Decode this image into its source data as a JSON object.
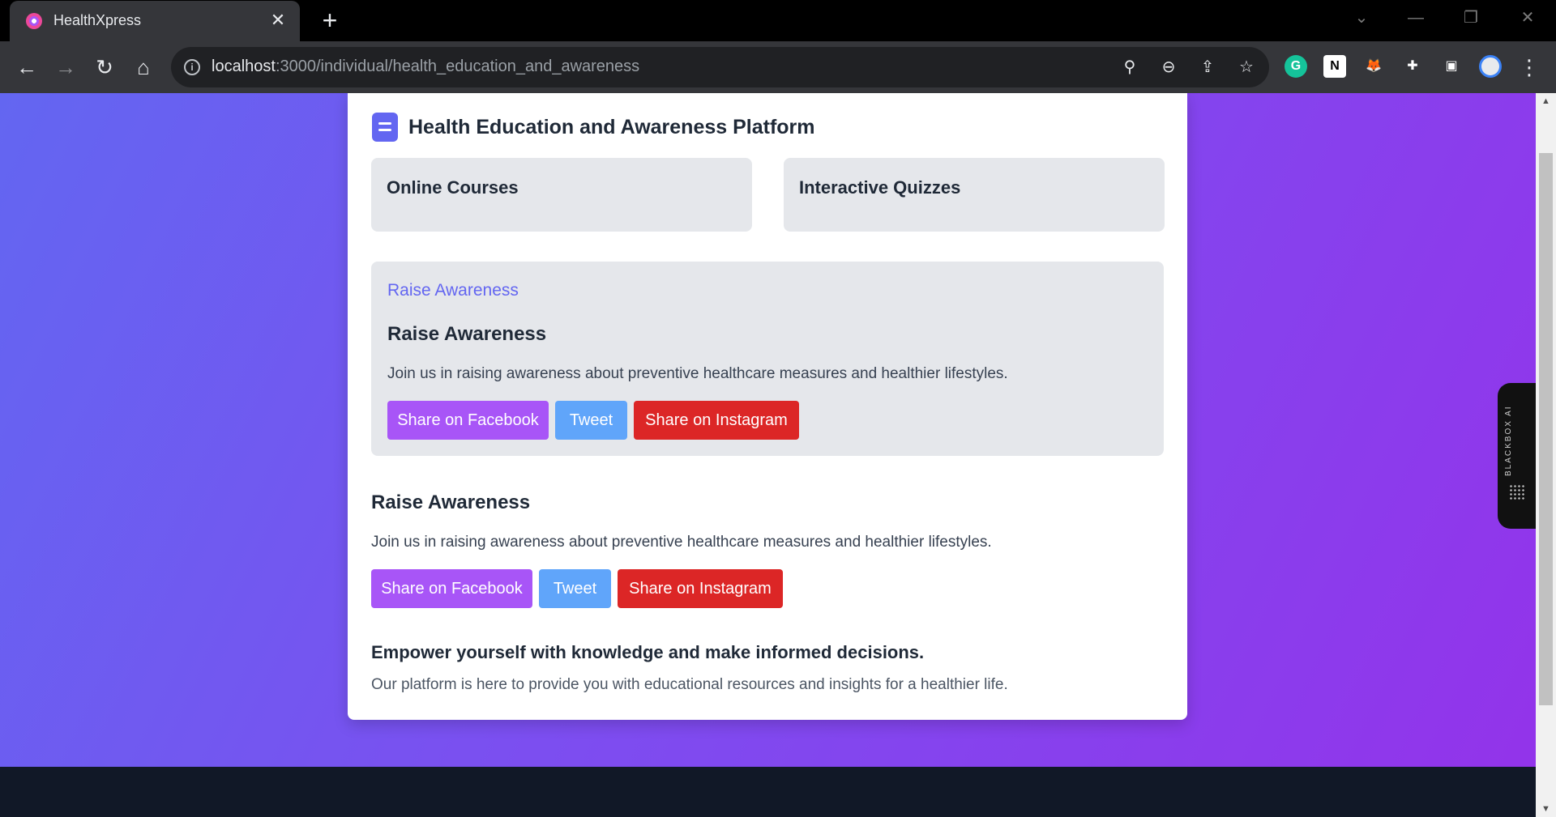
{
  "browser": {
    "tab_title": "HealthXpress",
    "tab_close": "✕",
    "new_tab": "+",
    "url_host": "localhost",
    "url_path": ":3000/individual/health_education_and_awareness",
    "window_controls": {
      "dropdown": "⌄",
      "minimize": "—",
      "restore": "❐",
      "close": "✕"
    },
    "nav": {
      "back": "←",
      "forward": "→",
      "reload": "↻",
      "home": "⌂"
    },
    "omnibox_icons": {
      "location": "⚲",
      "zoom": "⊖",
      "share": "⇪",
      "bookmark": "☆"
    },
    "extensions": [
      {
        "name": "grammarly",
        "glyph": "G",
        "color": "#15c39a"
      },
      {
        "name": "notion",
        "glyph": "N",
        "color": "#ffffff"
      },
      {
        "name": "metamask",
        "glyph": "🦊",
        "color": "#f6851b"
      },
      {
        "name": "extensions-puzzle",
        "glyph": "✚",
        "color": "#e8eaed"
      },
      {
        "name": "side-panel",
        "glyph": "▣",
        "color": "#e8eaed"
      }
    ],
    "menu": "⋮"
  },
  "page": {
    "title": "Health Education and Awareness Platform",
    "tiles": [
      "Online Courses",
      "Interactive Quizzes"
    ],
    "panel": {
      "link": "Raise Awareness",
      "heading": "Raise Awareness",
      "text": "Join us in raising awareness about preventive healthcare measures and healthier lifestyles.",
      "buttons": {
        "facebook": "Share on Facebook",
        "tweet": "Tweet",
        "instagram": "Share on Instagram"
      }
    },
    "section": {
      "heading": "Raise Awareness",
      "text": "Join us in raising awareness about preventive healthcare measures and healthier lifestyles.",
      "buttons": {
        "facebook": "Share on Facebook",
        "tweet": "Tweet",
        "instagram": "Share on Instagram"
      }
    },
    "empower": {
      "heading": "Empower yourself with knowledge and make informed decisions.",
      "text": "Our platform is here to provide you with educational resources and insights for a healthier life."
    }
  },
  "side_widget": {
    "label": "BLACKBOX AI"
  },
  "colors": {
    "gradient_start": "#6366f1",
    "gradient_end": "#9333ea",
    "accent": "#6366f1",
    "facebook": "#a855f7",
    "tweet": "#60a5fa",
    "instagram": "#dc2626",
    "footer": "#111827"
  }
}
